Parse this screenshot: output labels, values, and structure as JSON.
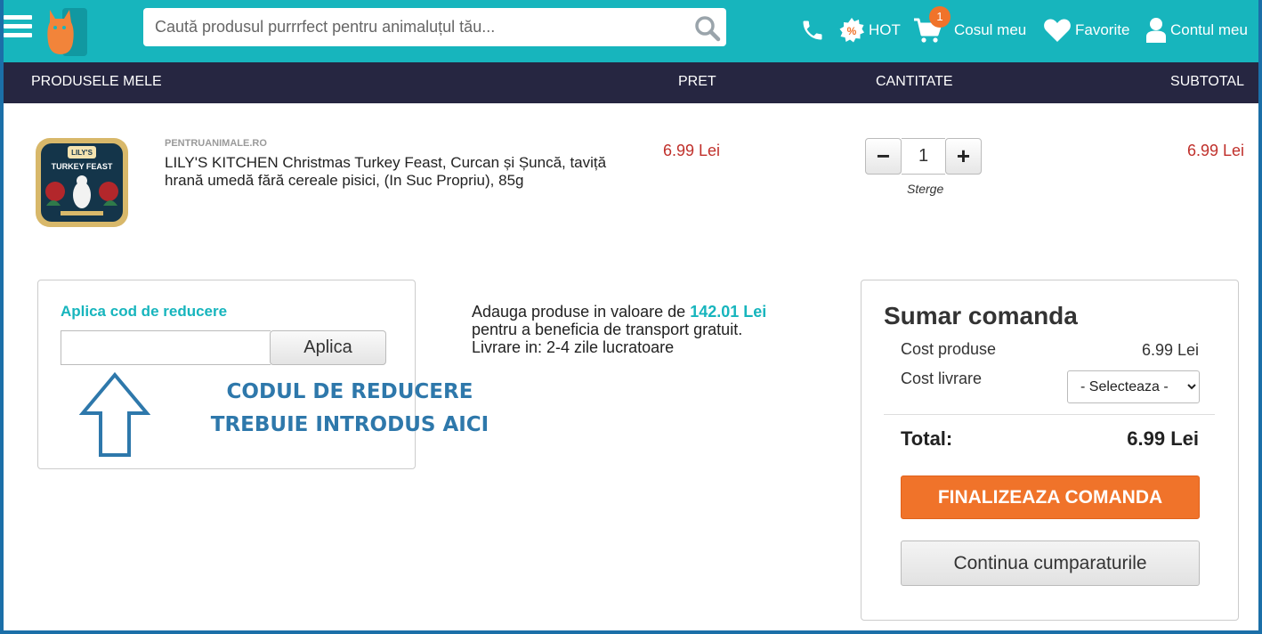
{
  "header": {
    "search_placeholder": "Caută produsul purrrfect pentru animaluțul tău...",
    "hot_label": "HOT",
    "cart_label": "Cosul meu",
    "cart_count": "1",
    "favorites_label": "Favorite",
    "account_label": "Contul meu",
    "colors": {
      "bar": "#17b5bd",
      "accent": "#f0732a"
    }
  },
  "columns": {
    "products": "PRODUSELE MELE",
    "price": "PRET",
    "quantity": "CANTITATE",
    "subtotal": "SUBTOTAL"
  },
  "cart_item": {
    "brand": "PENTRUANIMALE.RO",
    "name": "LILY'S KITCHEN Christmas Turkey Feast, Curcan și Șuncă, taviță hrană umedă fără cereale pisici, (In Suc Propriu), 85g",
    "price": "6.99 Lei",
    "quantity": "1",
    "remove_label": "Sterge",
    "subtotal": "6.99 Lei",
    "image_text": {
      "brand": "LILY'S",
      "title": "TURKEY FEAST"
    }
  },
  "coupon": {
    "title": "Aplica cod de reducere",
    "input_value": "",
    "apply_label": "Aplica",
    "annotation_line1": "CODUL DE REDUCERE",
    "annotation_line2": "TREBUIE INTRODUS AICI"
  },
  "shipping": {
    "prefix": "Adauga produse in valoare de",
    "amount": "142.01 Lei",
    "line2": "pentru a beneficia de transport gratuit.",
    "line3": "Livrare in: 2-4 zile lucratoare"
  },
  "summary": {
    "title": "Sumar comanda",
    "products_cost_label": "Cost produse",
    "products_cost_value": "6.99 Lei",
    "delivery_label": "Cost livrare",
    "delivery_select": "- Selecteaza -",
    "total_label": "Total:",
    "total_value": "6.99 Lei",
    "checkout_label": "FINALIZEAZA COMANDA",
    "continue_label": "Continua cumparaturile"
  }
}
